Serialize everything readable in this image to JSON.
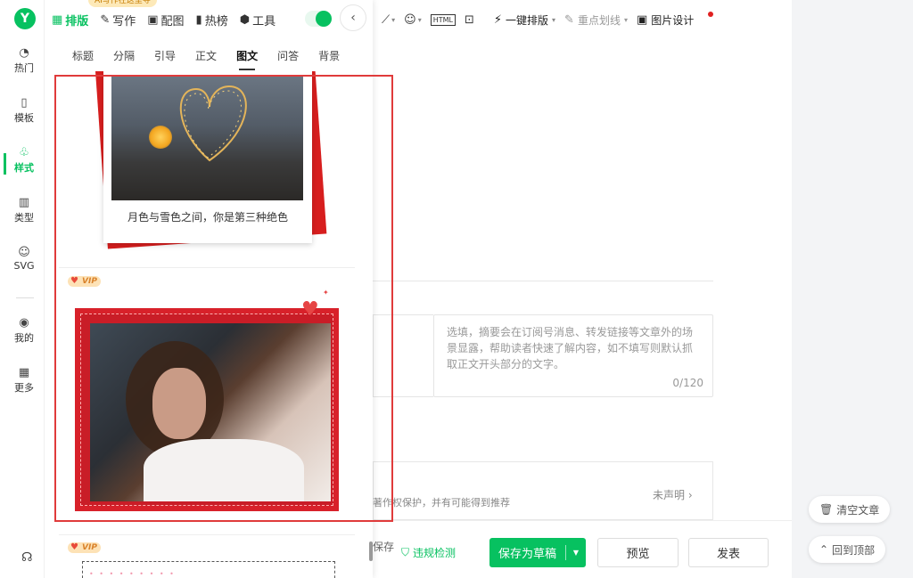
{
  "editor": {
    "toolbar": {
      "html_label": "HTML",
      "one_click_label": "一键排版",
      "highlight_label": "重点划线",
      "image_design_label": "图片设计"
    },
    "summary_placeholder": "选填，摘要会在订阅号消息、转发链接等文章外的场景显露，帮助读者快速了解内容，如不填写则默认抓取正文开头部分的文字。",
    "summary_count": "0/120",
    "declare_text": "著作权保护，并有可能得到推荐",
    "declare_status": "未声明 ›",
    "bottom": {
      "save_text": "保存",
      "check_label": "违规检测",
      "save_draft": "保存为草稿",
      "preview": "预览",
      "publish": "发表"
    },
    "side": {
      "clear": "清空文章",
      "top": "回到顶部"
    }
  },
  "plugin": {
    "logo": "Y",
    "ai_badge": "AI写作在这里寻",
    "top_tabs": [
      {
        "icon": "▦",
        "label": "排版"
      },
      {
        "icon": "✎",
        "label": "写作"
      },
      {
        "icon": "▣",
        "label": "配图"
      },
      {
        "icon": "▮",
        "label": "热榜"
      },
      {
        "icon": "⬢",
        "label": "工具"
      }
    ],
    "nav": [
      {
        "icon": "◔",
        "label": "热门"
      },
      {
        "icon": "▯",
        "label": "模板"
      },
      {
        "icon": "♧",
        "label": "样式"
      },
      {
        "icon": "▥",
        "label": "类型"
      },
      {
        "icon": "☺",
        "label": "SVG"
      },
      {
        "icon": "◉",
        "label": "我的"
      },
      {
        "icon": "▦",
        "label": "更多"
      }
    ],
    "sub_tabs": [
      "标题",
      "分隔",
      "引导",
      "正文",
      "图文",
      "问答",
      "背景"
    ],
    "card1_caption": "月色与雪色之间，你是第三种绝色",
    "vip_label": "VIP"
  }
}
